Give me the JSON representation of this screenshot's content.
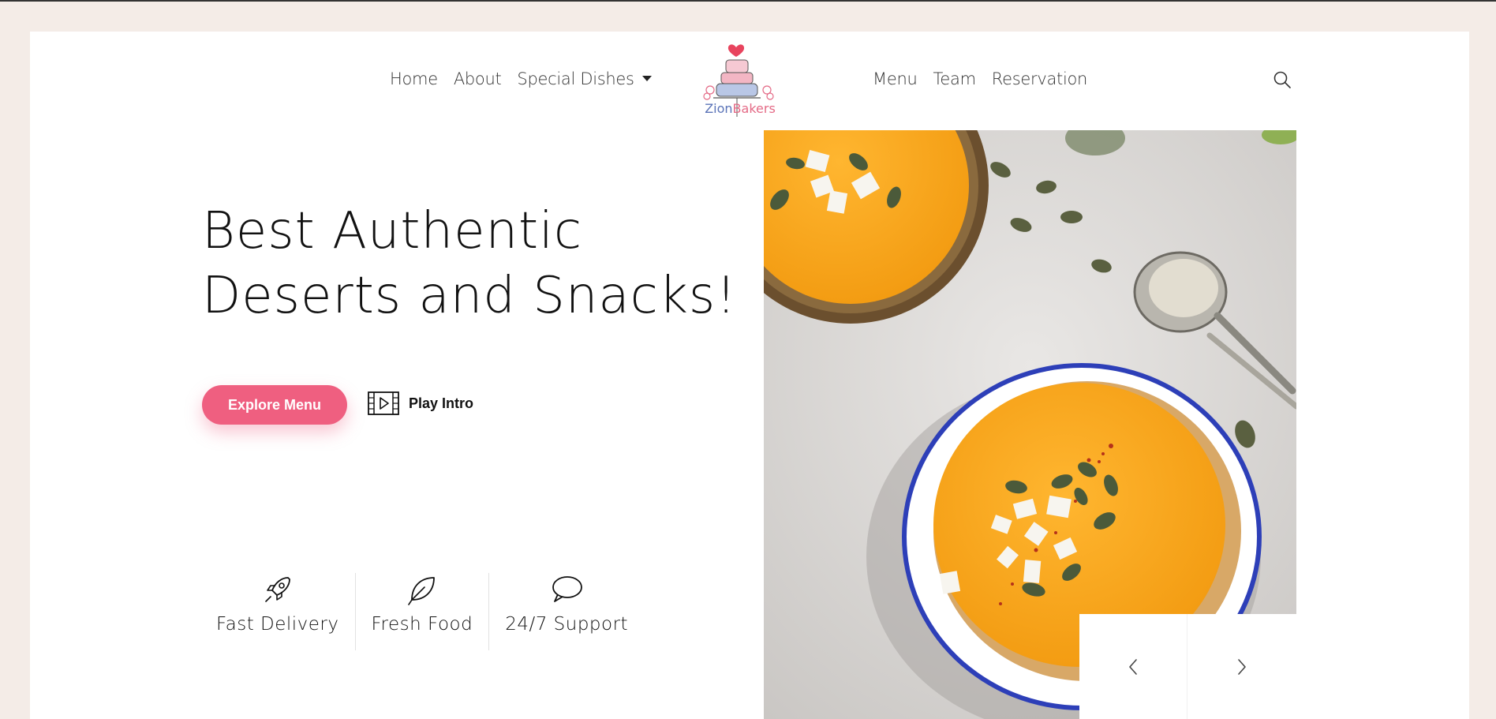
{
  "nav": {
    "left_links": [
      "Home",
      "About",
      "Special Dishes"
    ],
    "right_links": [
      "Menu",
      "Team",
      "Reservation"
    ],
    "dropdown_icon": "caret-down-icon",
    "search_icon": "search-icon"
  },
  "logo": {
    "word1": "Zion",
    "word2": "Bakers",
    "colors": {
      "primary": "#5b74b8",
      "accent": "#e46a86",
      "heart": "#e8445e"
    }
  },
  "hero": {
    "title_line1": "Best Authentic",
    "title_line2": "Deserts and Snacks!",
    "explore_button": "Explore Menu",
    "play_label": "Play Intro",
    "play_icon": "film-play-icon"
  },
  "features": [
    {
      "label": "Fast Delivery",
      "icon": "rocket-icon"
    },
    {
      "label": "Fresh Food",
      "icon": "leaf-icon"
    },
    {
      "label": "24/7 Support",
      "icon": "chat-bubble-icon"
    }
  ],
  "slider": {
    "prev_icon": "chevron-left-icon",
    "next_icon": "chevron-right-icon"
  },
  "colors": {
    "accent": "#ef5f80",
    "page_bg": "#f4ece7",
    "card_bg": "#ffffff"
  }
}
